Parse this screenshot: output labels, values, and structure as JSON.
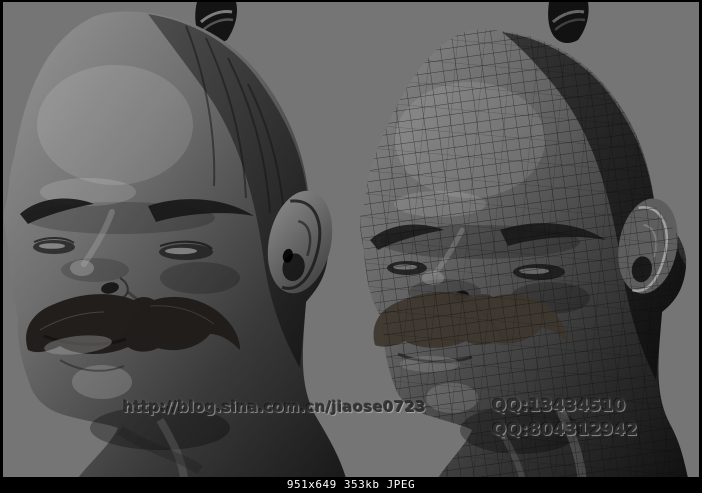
{
  "watermarks": {
    "blog_url": "http://blog.sina.com.cn/jiaose0723",
    "qq_primary": "QQ:13434510",
    "qq_secondary": "QQ:804312942"
  },
  "status_bar": {
    "caption": "951x649 353kb JPEG"
  },
  "colors": {
    "canvas_background": "#757575",
    "frame": "#000000",
    "status_bar_background": "#000000",
    "status_bar_text": "#ffffff",
    "watermark_text": "#2f2f2f"
  }
}
